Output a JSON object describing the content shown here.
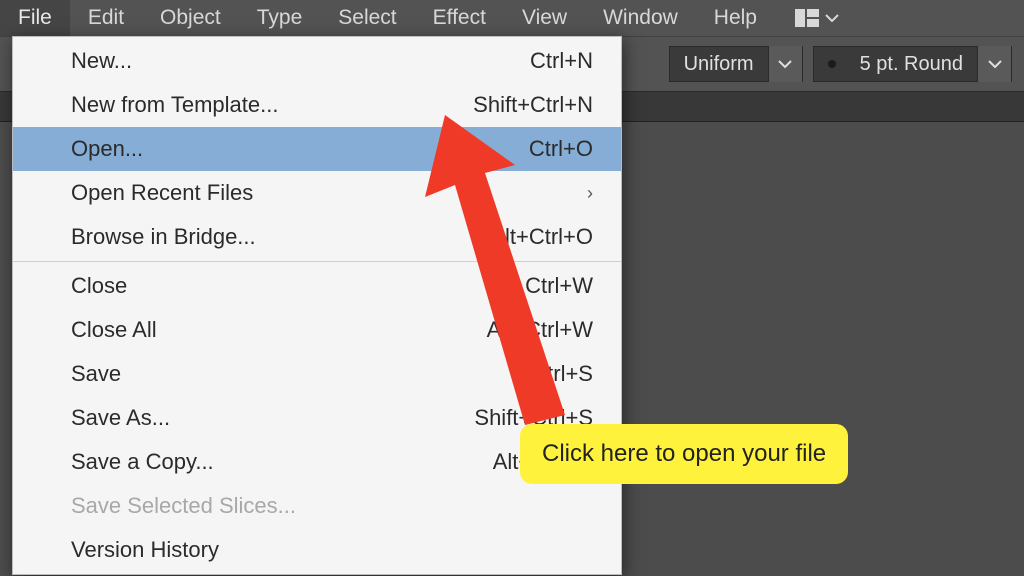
{
  "menubar": {
    "items": [
      "File",
      "Edit",
      "Object",
      "Type",
      "Select",
      "Effect",
      "View",
      "Window",
      "Help"
    ]
  },
  "toolbar": {
    "uniform_label": "Uniform",
    "brush_label": "5 pt. Round"
  },
  "file_menu": {
    "items": [
      {
        "label": "New...",
        "shortcut": "Ctrl+N"
      },
      {
        "label": "New from Template...",
        "shortcut": "Shift+Ctrl+N"
      },
      {
        "label": "Open...",
        "shortcut": "Ctrl+O",
        "highlight": true
      },
      {
        "label": "Open Recent Files",
        "submenu": true
      },
      {
        "label": "Browse in Bridge...",
        "shortcut": "Alt+Ctrl+O"
      },
      {
        "sep": true
      },
      {
        "label": "Close",
        "shortcut": "Ctrl+W"
      },
      {
        "label": "Close All",
        "shortcut": "Alt+Ctrl+W"
      },
      {
        "label": "Save",
        "shortcut": "Ctrl+S"
      },
      {
        "label": "Save As...",
        "shortcut": "Shift+Ctrl+S"
      },
      {
        "label": "Save a Copy...",
        "shortcut": "Alt+Ctrl+S"
      },
      {
        "label": "Save Selected Slices...",
        "disabled": true
      },
      {
        "label": "Version History"
      }
    ]
  },
  "callout": {
    "text": "Click here to open your file"
  }
}
